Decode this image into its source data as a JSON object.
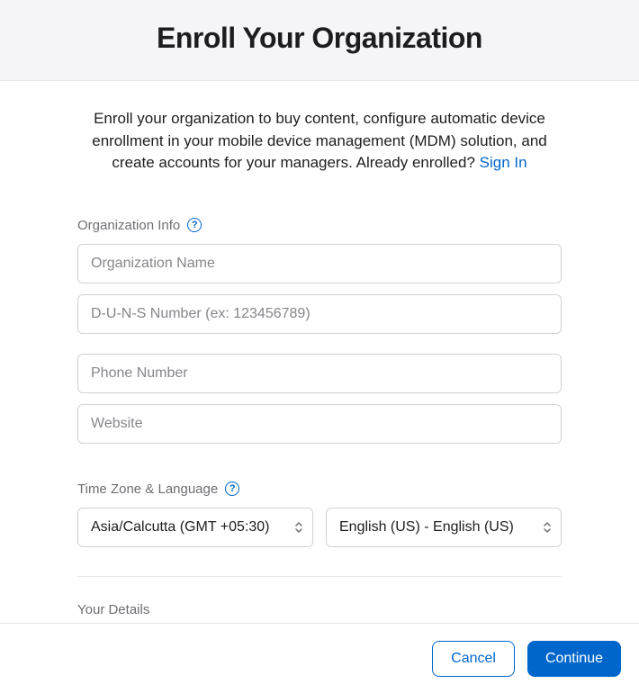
{
  "header": {
    "title": "Enroll Your Organization"
  },
  "intro": {
    "text": "Enroll your organization to buy content, configure automatic device enrollment in your mobile device management (MDM) solution, and create accounts for your managers. Already enrolled? ",
    "link": "Sign In"
  },
  "sections": {
    "org_info": {
      "label": "Organization Info",
      "fields": {
        "org_name_placeholder": "Organization Name",
        "duns_placeholder": "D-U-N-S Number (ex: 123456789)",
        "phone_placeholder": "Phone Number",
        "website_placeholder": "Website"
      }
    },
    "timezone_lang": {
      "label": "Time Zone & Language",
      "timezone_value": "Asia/Calcutta (GMT +05:30)",
      "language_value": "English (US) - English (US)"
    },
    "your_details": {
      "label": "Your Details"
    }
  },
  "footer": {
    "cancel": "Cancel",
    "continue": "Continue"
  }
}
